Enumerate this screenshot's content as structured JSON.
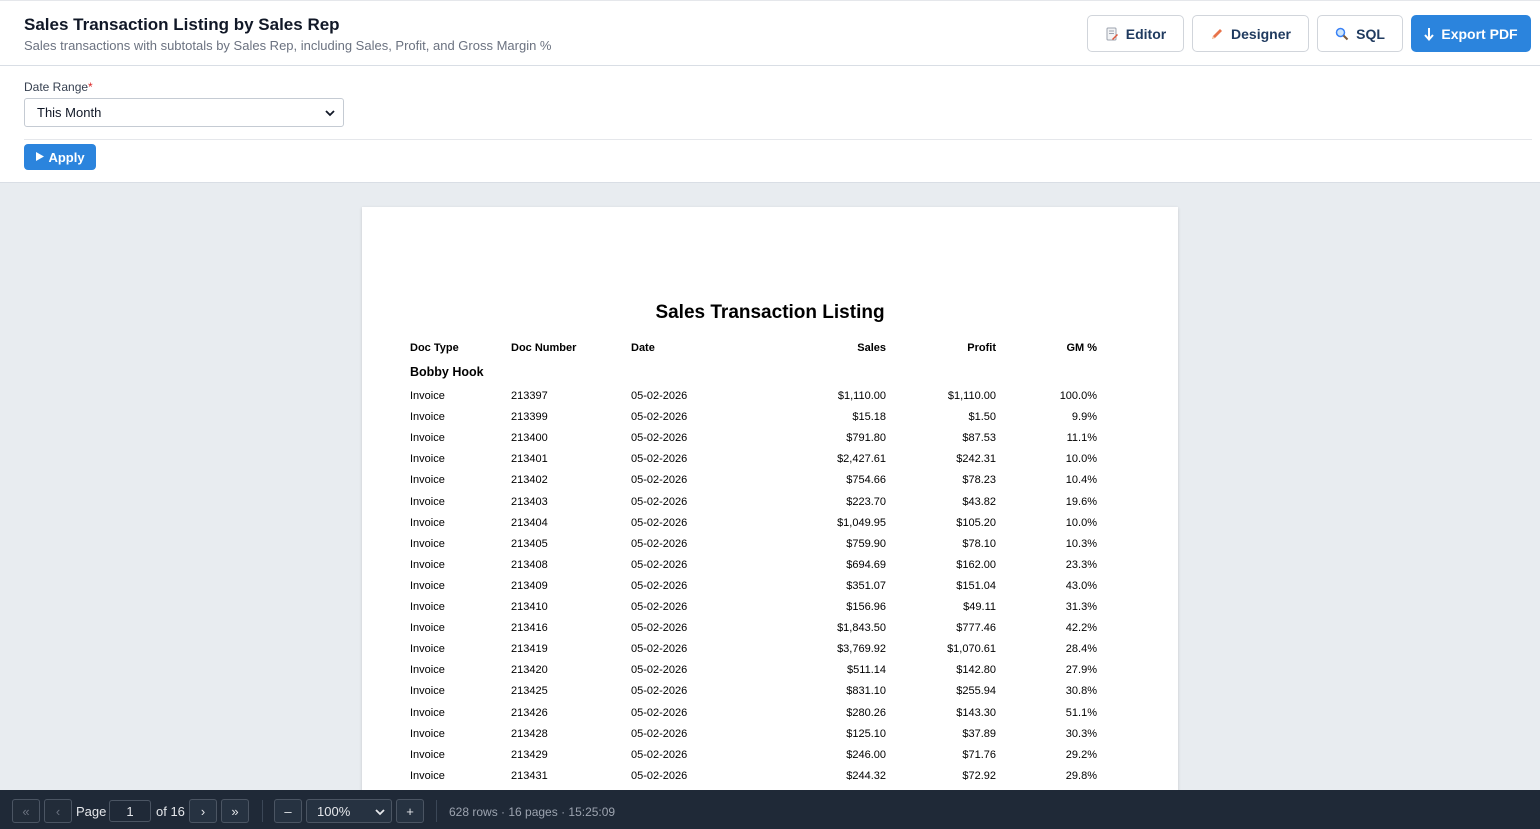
{
  "header": {
    "title": "Sales Transaction Listing by Sales Rep",
    "subtitle": "Sales transactions with subtotals by Sales Rep, including Sales, Profit, and Gross Margin %",
    "buttons": {
      "editor": "Editor",
      "designer": "Designer",
      "sql": "SQL",
      "export": "Export PDF"
    }
  },
  "filter": {
    "date_range_label": "Date Range",
    "required_mark": "*",
    "date_range_value": "This Month",
    "apply_label": "Apply"
  },
  "report": {
    "title": "Sales Transaction Listing",
    "columns": [
      "Doc Type",
      "Doc Number",
      "Date",
      "Sales",
      "Profit",
      "GM %"
    ],
    "group_name": "Bobby Hook",
    "rows": [
      [
        "Invoice",
        "213397",
        "05-02-2026",
        "$1,110.00",
        "$1,110.00",
        "100.0%"
      ],
      [
        "Invoice",
        "213399",
        "05-02-2026",
        "$15.18",
        "$1.50",
        "9.9%"
      ],
      [
        "Invoice",
        "213400",
        "05-02-2026",
        "$791.80",
        "$87.53",
        "11.1%"
      ],
      [
        "Invoice",
        "213401",
        "05-02-2026",
        "$2,427.61",
        "$242.31",
        "10.0%"
      ],
      [
        "Invoice",
        "213402",
        "05-02-2026",
        "$754.66",
        "$78.23",
        "10.4%"
      ],
      [
        "Invoice",
        "213403",
        "05-02-2026",
        "$223.70",
        "$43.82",
        "19.6%"
      ],
      [
        "Invoice",
        "213404",
        "05-02-2026",
        "$1,049.95",
        "$105.20",
        "10.0%"
      ],
      [
        "Invoice",
        "213405",
        "05-02-2026",
        "$759.90",
        "$78.10",
        "10.3%"
      ],
      [
        "Invoice",
        "213408",
        "05-02-2026",
        "$694.69",
        "$162.00",
        "23.3%"
      ],
      [
        "Invoice",
        "213409",
        "05-02-2026",
        "$351.07",
        "$151.04",
        "43.0%"
      ],
      [
        "Invoice",
        "213410",
        "05-02-2026",
        "$156.96",
        "$49.11",
        "31.3%"
      ],
      [
        "Invoice",
        "213416",
        "05-02-2026",
        "$1,843.50",
        "$777.46",
        "42.2%"
      ],
      [
        "Invoice",
        "213419",
        "05-02-2026",
        "$3,769.92",
        "$1,070.61",
        "28.4%"
      ],
      [
        "Invoice",
        "213420",
        "05-02-2026",
        "$511.14",
        "$142.80",
        "27.9%"
      ],
      [
        "Invoice",
        "213425",
        "05-02-2026",
        "$831.10",
        "$255.94",
        "30.8%"
      ],
      [
        "Invoice",
        "213426",
        "05-02-2026",
        "$280.26",
        "$143.30",
        "51.1%"
      ],
      [
        "Invoice",
        "213428",
        "05-02-2026",
        "$125.10",
        "$37.89",
        "30.3%"
      ],
      [
        "Invoice",
        "213429",
        "05-02-2026",
        "$246.00",
        "$71.76",
        "29.2%"
      ],
      [
        "Invoice",
        "213431",
        "05-02-2026",
        "$244.32",
        "$72.92",
        "29.8%"
      ]
    ]
  },
  "pager": {
    "first": "«",
    "prev": "‹",
    "page_label": "Page",
    "page_value": "1",
    "of_label": "of 16",
    "next": "›",
    "last": "»",
    "zoom_out": "–",
    "zoom_value": "100%",
    "zoom_in": "+",
    "status": "628 rows · 16 pages · 15:25:09"
  },
  "colors": {
    "accent": "#2b84dd",
    "pager_bg": "#1f2937",
    "viewer_bg": "#e8ecf0"
  }
}
